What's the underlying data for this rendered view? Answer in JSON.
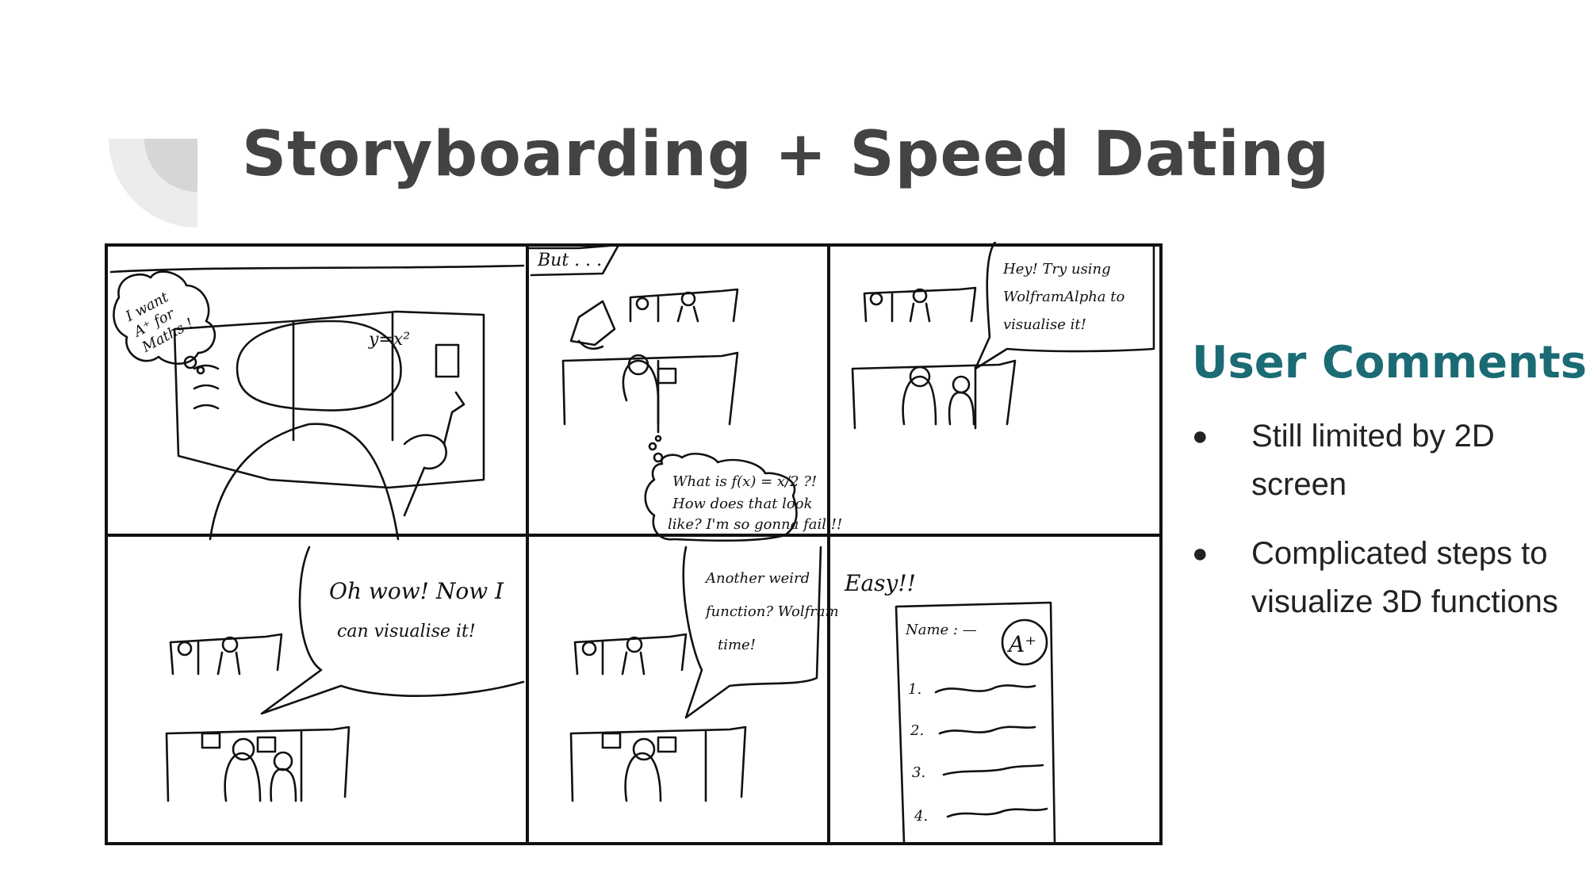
{
  "slide": {
    "title": "Storyboarding + Speed Dating"
  },
  "storyboard": {
    "panel1": {
      "speech": [
        "I want",
        "A⁺ for",
        "Maths !"
      ],
      "board_formula": "y=x²"
    },
    "panel2": {
      "caption": "But . . .",
      "thought": [
        "What is f(x) = x/2 ?!",
        "How does that look",
        "like? I'm so gonna fail !!"
      ]
    },
    "panel3": {
      "speech": [
        "Hey! Try using",
        "WolframAlpha to",
        "visualise it!"
      ]
    },
    "panel4": {
      "speech": [
        "Oh wow! Now I",
        "can visualise it!"
      ]
    },
    "panel5": {
      "speech": [
        "Another weird",
        "function? Wolfram",
        "time!"
      ]
    },
    "panel6": {
      "caption": "Easy!!",
      "paper_name": "Name : —",
      "grade": "A⁺",
      "items": [
        "1.",
        "2.",
        "3.",
        "4."
      ]
    }
  },
  "side": {
    "heading": "User Comments",
    "bullet_symbol": "●",
    "comments": [
      {
        "text": "Still limited by 2D screen"
      },
      {
        "text": "Complicated steps to visualize 3D functions"
      }
    ]
  },
  "colors": {
    "title": "#434343",
    "heading": "#1a6b74",
    "body_text": "#222222",
    "corner_decoration": "#e6e6e6"
  }
}
